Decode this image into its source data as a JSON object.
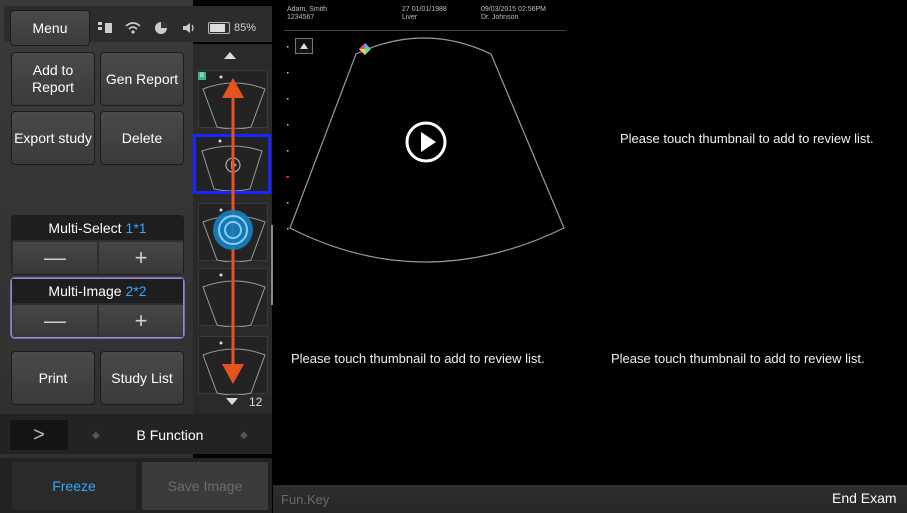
{
  "header": {
    "menu_label": "Menu",
    "battery_percent": "85%"
  },
  "patient": {
    "name": "Adam, Smith",
    "id": "1234567",
    "dob": "27 01/01/1988",
    "exam": "Liver",
    "datetime": "09/03/2015 02:56PM",
    "doctor": "Dr. Johnson"
  },
  "buttons": {
    "add_to_report": "Add to\nReport",
    "gen_report": "Gen Report",
    "export_study": "Export study",
    "delete": "Delete",
    "print": "Print",
    "study_list": "Study List"
  },
  "multi_select": {
    "label": "Multi-Select",
    "value": "1*1",
    "minus": "—",
    "plus": "+"
  },
  "multi_image": {
    "label": "Multi-Image",
    "value": "2*2",
    "minus": "—",
    "plus": "+"
  },
  "function_bar": {
    "chevron": ">",
    "label": "B Function"
  },
  "bottom_left": {
    "freeze": "Freeze",
    "save_image": "Save Image"
  },
  "thumbnails": {
    "count": "12"
  },
  "viewer": {
    "review_message": "Please touch thumbnail to add to review list."
  },
  "bottom_bar": {
    "fun_key": "Fun.Key",
    "end_exam": "End Exam"
  },
  "colors": {
    "accent_blue": "#32a8ff",
    "selection_blue": "#1a24ff",
    "arrow_orange": "#e8521f",
    "multi_image_border": "#9b86c7"
  }
}
